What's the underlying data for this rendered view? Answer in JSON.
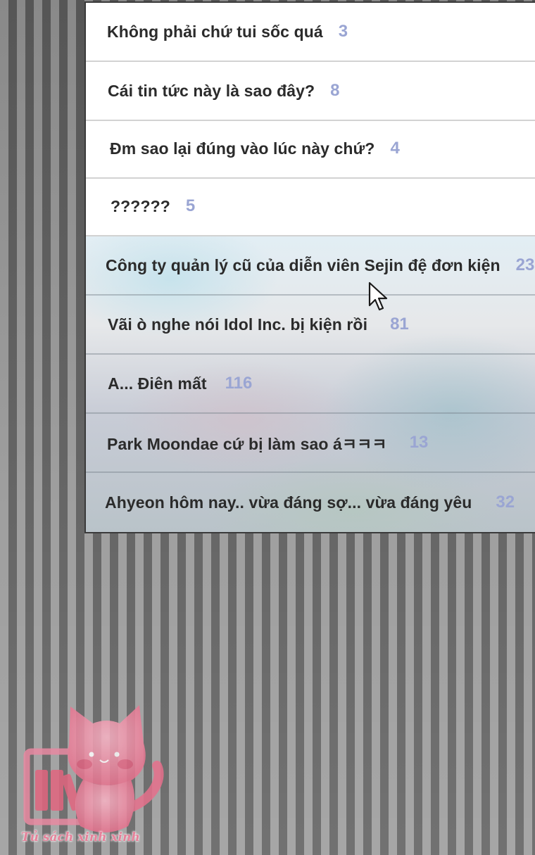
{
  "topics": [
    {
      "title": "Không phải chứ tui sốc quá",
      "count": "3"
    },
    {
      "title": "Cái tin tức này là sao đây?",
      "count": "8"
    },
    {
      "title": "Đm sao lại đúng vào lúc này chứ?",
      "count": "4"
    },
    {
      "title": "??????",
      "count": "5"
    },
    {
      "title": "Công ty quản lý cũ của diễn viên Sejin đệ đơn kiện",
      "count": "23"
    },
    {
      "title": "Vãi ò nghe nói Idol Inc. bị kiện rồi",
      "count": "81"
    },
    {
      "title": "A... Điên mất",
      "count": "116"
    },
    {
      "title": "Park Moondae cứ bị làm sao áㅋㅋㅋ",
      "count": "13"
    },
    {
      "title": "Ahyeon hôm nay.. vừa đáng sợ... vừa đáng yêu",
      "count": "32"
    }
  ],
  "icons": {
    "cursor": "mouse-pointer-icon",
    "watermark": "cat-bookshelf-logo-icon"
  },
  "watermark": {
    "text": "Tủ sách xinh xinh"
  },
  "colors": {
    "count_accent": "#9aa5d3",
    "title_text": "#2b2b2b",
    "watermark_pink": "#e5829a"
  }
}
